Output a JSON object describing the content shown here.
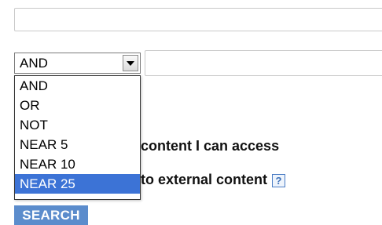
{
  "search_form": {
    "keyword_input": {
      "value": ""
    },
    "operator_select": {
      "selected": "AND",
      "options": [
        "AND",
        "OR",
        "NOT",
        "NEAR 5",
        "NEAR 10",
        "NEAR 25"
      ],
      "highlighted": "NEAR 25"
    },
    "second_keyword_input": {
      "value": ""
    },
    "checkbox_1_label_visible": "content I can access",
    "checkbox_2_label_visible": "to external content",
    "help_icon_glyph": "?",
    "search_button_label": "SEARCH"
  },
  "colors": {
    "highlight": "#3c73d6",
    "button": "#5b8ccc",
    "help_icon": "#3b6fb8"
  },
  "icons": {
    "dropdown_arrow": "chevron-down-icon",
    "help": "help-icon"
  }
}
